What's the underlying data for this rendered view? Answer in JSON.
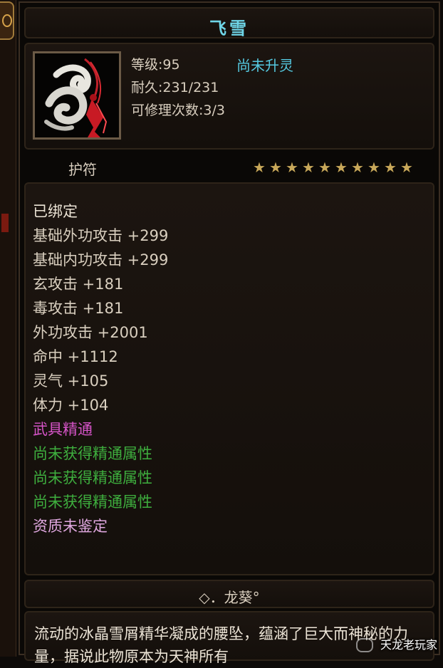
{
  "item": {
    "name": "飞雪",
    "level": "等级:95",
    "spirit_status": "尚未升灵",
    "durability": "耐久:231/231",
    "repair_count": "可修理次数:3/3",
    "type": "护符",
    "stars": 10,
    "icon": "jade-pendant-icon"
  },
  "attributes": [
    {
      "text": "已绑定",
      "kind": "bound"
    },
    {
      "text": "基础外功攻击 +299",
      "kind": "normal"
    },
    {
      "text": "基础内功攻击 +299",
      "kind": "normal"
    },
    {
      "text": "玄攻击 +181",
      "kind": "normal"
    },
    {
      "text": "毒攻击 +181",
      "kind": "normal"
    },
    {
      "text": "外功攻击 +2001",
      "kind": "normal"
    },
    {
      "text": "命中 +1112",
      "kind": "normal"
    },
    {
      "text": "灵气 +105",
      "kind": "normal"
    },
    {
      "text": "体力 +104",
      "kind": "normal"
    },
    {
      "text": "武具精通",
      "kind": "mastery"
    },
    {
      "text": "尚未获得精通属性",
      "kind": "green"
    },
    {
      "text": "尚未获得精通属性",
      "kind": "green"
    },
    {
      "text": "尚未获得精通属性",
      "kind": "green"
    },
    {
      "text": "资质未鉴定",
      "kind": "quality"
    }
  ],
  "set_name": "◇．龙葵°",
  "description": "流动的冰晶雪屑精华凝成的腰坠，蕴涵了巨大而神秘的力量，据说此物原本为天神所有",
  "watermark": "天龙老玩家",
  "colors": {
    "title": "#6fd6e8",
    "spirit": "#55c9e0",
    "mastery": "#d654c8",
    "green": "#3eae3e",
    "star": "#c8a85a"
  }
}
